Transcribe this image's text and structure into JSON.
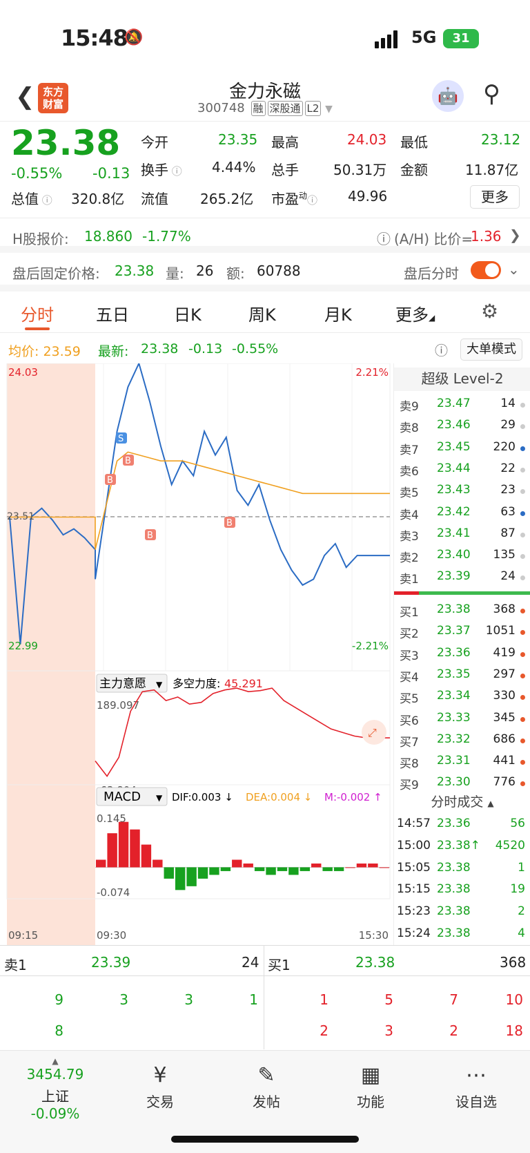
{
  "status": {
    "time": "15:48",
    "network": "5G",
    "battery": "31"
  },
  "header": {
    "title": "金力永磁",
    "code": "300748",
    "tags": [
      "融",
      "深股通",
      "L2"
    ],
    "logo": "东方财富"
  },
  "quote": {
    "price": "23.38",
    "change_pct": "-0.55%",
    "change": "-0.13",
    "open_label": "今开",
    "open": "23.35",
    "high_label": "最高",
    "high": "24.03",
    "low_label": "最低",
    "low": "23.12",
    "turnover_label": "换手",
    "turnover": "4.44%",
    "volume_label": "总手",
    "volume": "50.31万",
    "amount_label": "金额",
    "amount": "11.87亿",
    "mktcap_label": "总值",
    "mktcap": "320.8亿",
    "float_label": "流值",
    "float": "265.2亿",
    "pe_label": "市盈",
    "pe_sup": "动",
    "pe": "49.96",
    "more": "更多"
  },
  "hshare": {
    "label": "H股报价:",
    "price": "18.860",
    "pct": "-1.77%",
    "ah_label": "(A/H) 比价=",
    "ah": "1.36"
  },
  "after_hours": {
    "label": "盘后固定价格:",
    "price": "23.38",
    "vol_label": "量:",
    "vol": "26",
    "amt_label": "额:",
    "amt": "60788",
    "switch_label": "盘后分时"
  },
  "tabs": [
    "分时",
    "五日",
    "日K",
    "周K",
    "月K",
    "更多"
  ],
  "info": {
    "avg_label": "均价:",
    "avg": "23.59",
    "latest_label": "最新:",
    "latest": "23.38",
    "chg": "-0.13",
    "pct": "-0.55%",
    "big_btn": "大单模式"
  },
  "chart_data": [
    {
      "type": "line",
      "title": "分时",
      "ylim": [
        22.99,
        24.03
      ],
      "y_labels": {
        "top": "24.03",
        "bottom": "22.99",
        "ref": "23.51",
        "top_pct": "2.21%",
        "bottom_pct": "-2.21%"
      },
      "x_labels": [
        "09:15",
        "09:30",
        "15:30"
      ],
      "series": [
        {
          "values": [
            23.51,
            23.08,
            23.51,
            23.54,
            23.5,
            23.45,
            23.47,
            23.44,
            23.4,
            23.3,
            23.55,
            23.8,
            23.95,
            24.03,
            23.9,
            23.75,
            23.62,
            23.7,
            23.65,
            23.8,
            23.72,
            23.78,
            23.6,
            23.55,
            23.62,
            23.5,
            23.4,
            23.33,
            23.28,
            23.3,
            23.38,
            23.42,
            23.34,
            23.38,
            23.38,
            23.38,
            23.38
          ]
        },
        {
          "values": [
            23.51,
            23.51,
            23.51,
            23.51,
            23.51,
            23.51,
            23.51,
            23.51,
            23.51,
            23.4,
            23.55,
            23.7,
            23.73,
            23.72,
            23.71,
            23.7,
            23.7,
            23.7,
            23.69,
            23.68,
            23.67,
            23.66,
            23.65,
            23.64,
            23.63,
            23.62,
            23.61,
            23.6,
            23.59,
            23.59,
            23.59,
            23.59,
            23.59,
            23.59,
            23.59,
            23.59,
            23.59
          ]
        }
      ],
      "markers": [
        "B",
        "S",
        "B",
        "B",
        "B"
      ]
    },
    {
      "type": "line",
      "title": "主力意愿",
      "label2": "多空力度:",
      "value": "45.291",
      "y_labels": {
        "top": "189.097",
        "bottom": "-63.804"
      },
      "ylim": [
        -63.804,
        189.097
      ],
      "series": [
        {
          "values": [
            -20,
            -63,
            -10,
            120,
            175,
            180,
            150,
            160,
            140,
            145,
            170,
            180,
            185,
            175,
            178,
            185,
            150,
            130,
            110,
            90,
            70,
            60,
            50,
            45,
            45,
            45
          ]
        }
      ]
    },
    {
      "type": "bar",
      "title": "MACD",
      "dif_label": "DIF:0.003 ↓",
      "dea_label": "DEA:0.004 ↓",
      "m_label": "M:-0.002 ↑",
      "y_labels": {
        "top": "0.145",
        "bottom": "-0.074"
      },
      "ylim": [
        -0.074,
        0.145
      ],
      "values": [
        0.02,
        0.09,
        0.12,
        0.1,
        0.06,
        0.02,
        -0.03,
        -0.06,
        -0.05,
        -0.03,
        -0.02,
        -0.01,
        0.02,
        0.01,
        -0.01,
        -0.02,
        -0.01,
        -0.02,
        -0.01,
        0.01,
        -0.01,
        -0.01,
        0.0,
        0.01,
        0.01,
        0.0
      ]
    }
  ],
  "orderbook": {
    "title": "超级 Level-2",
    "asks": [
      {
        "l": "卖9",
        "p": "23.47",
        "v": "14"
      },
      {
        "l": "卖8",
        "p": "23.46",
        "v": "29"
      },
      {
        "l": "卖7",
        "p": "23.45",
        "v": "220"
      },
      {
        "l": "卖6",
        "p": "23.44",
        "v": "22"
      },
      {
        "l": "卖5",
        "p": "23.43",
        "v": "23"
      },
      {
        "l": "卖4",
        "p": "23.42",
        "v": "63"
      },
      {
        "l": "卖3",
        "p": "23.41",
        "v": "87"
      },
      {
        "l": "卖2",
        "p": "23.40",
        "v": "135"
      },
      {
        "l": "卖1",
        "p": "23.39",
        "v": "24"
      }
    ],
    "bids": [
      {
        "l": "买1",
        "p": "23.38",
        "v": "368"
      },
      {
        "l": "买2",
        "p": "23.37",
        "v": "1051"
      },
      {
        "l": "买3",
        "p": "23.36",
        "v": "419"
      },
      {
        "l": "买4",
        "p": "23.35",
        "v": "297"
      },
      {
        "l": "买5",
        "p": "23.34",
        "v": "330"
      },
      {
        "l": "买6",
        "p": "23.33",
        "v": "345"
      },
      {
        "l": "买7",
        "p": "23.32",
        "v": "686"
      },
      {
        "l": "买8",
        "p": "23.31",
        "v": "441"
      },
      {
        "l": "买9",
        "p": "23.30",
        "v": "776"
      }
    ],
    "trades_title": "分时成交",
    "trades": [
      {
        "t": "14:57",
        "p": "23.36",
        "v": "56",
        "up": ""
      },
      {
        "t": "15:00",
        "p": "23.38",
        "v": "4520",
        "up": "↑"
      },
      {
        "t": "15:05",
        "p": "23.38",
        "v": "1",
        "up": ""
      },
      {
        "t": "15:15",
        "p": "23.38",
        "v": "19",
        "up": ""
      },
      {
        "t": "15:23",
        "p": "23.38",
        "v": "2",
        "up": ""
      },
      {
        "t": "15:24",
        "p": "23.38",
        "v": "4",
        "up": ""
      }
    ]
  },
  "queue": {
    "ask_label": "卖1",
    "ask_price": "23.39",
    "ask_vol": "24",
    "bid_label": "买1",
    "bid_price": "23.38",
    "bid_vol": "368",
    "ask_row1": [
      "9",
      "3",
      "3",
      "1"
    ],
    "ask_row2": [
      "8"
    ],
    "bid_row1": [
      "1",
      "5",
      "7",
      "10"
    ],
    "bid_row2": [
      "2",
      "3",
      "2",
      "18"
    ]
  },
  "tabbar": {
    "index_value": "3454.79",
    "index_name": "上证",
    "index_pct": "-0.09%",
    "items": [
      {
        "label": "交易",
        "icon": "¥"
      },
      {
        "label": "发帖",
        "icon": "✎"
      },
      {
        "label": "功能",
        "icon": "▦"
      },
      {
        "label": "设自选",
        "icon": "⋯"
      }
    ]
  }
}
